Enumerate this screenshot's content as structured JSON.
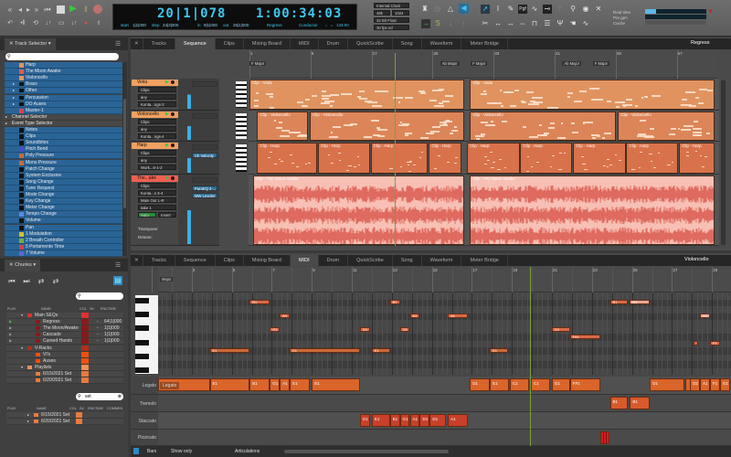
{
  "toolbar": {
    "counter_main": "20|1|078",
    "counter_time": "1:00:34:03",
    "start_label": "start",
    "start": "1|1|000",
    "step_label": "step",
    "step": "24|3|000",
    "in_label": "in",
    "in": "9|1|000",
    "out_label": "out",
    "out": "25|1|000",
    "chunk": "Regress",
    "conductor": "Conductor",
    "tempo": "134.00",
    "clock": "Internal Clock",
    "rate": "48k",
    "buffer": "1024",
    "bit_depth": "32 Bit Float",
    "fps": "30 fps nd",
    "realtime_label": "Real time",
    "pregen_label": "Pre gen",
    "cache_label": "Cache",
    "realtime_level": 0.18,
    "accent": "#3ec7f2"
  },
  "track_selector": {
    "title": "Track Selector",
    "search_placeholder": "",
    "items": [
      {
        "label": "Harp",
        "type": "track",
        "color": "#e8925a"
      },
      {
        "label": "The Moon Awake",
        "type": "track",
        "color": "#e05a4a"
      },
      {
        "label": "Violoncello",
        "type": "track",
        "color": "#e8925a"
      },
      {
        "label": "Brass",
        "type": "folder"
      },
      {
        "label": "Other",
        "type": "folder"
      },
      {
        "label": "Percussion",
        "type": "folder"
      },
      {
        "label": "DO Auxes",
        "type": "folder"
      },
      {
        "label": "Master-1",
        "type": "track",
        "color": "#e0404a"
      },
      {
        "label": "Channel Selector",
        "type": "group"
      },
      {
        "label": "Event Type Selector",
        "type": "group"
      },
      {
        "label": "Notes",
        "type": "event",
        "color": "#111"
      },
      {
        "label": "Clips",
        "type": "event",
        "color": "#111"
      },
      {
        "label": "Soundbites",
        "type": "event",
        "color": "#111"
      },
      {
        "label": "Pitch Bend",
        "type": "event",
        "color": "#4a4ad0"
      },
      {
        "label": "Poly Pressure",
        "type": "event",
        "color": "#c86a3a"
      },
      {
        "label": "Mono Pressure",
        "type": "event",
        "color": "#c86a3a"
      },
      {
        "label": "Patch Change",
        "type": "event",
        "color": "#111"
      },
      {
        "label": "System Exclusive",
        "type": "event",
        "color": "#111"
      },
      {
        "label": "Song Change",
        "type": "event",
        "color": "#111"
      },
      {
        "label": "Tune Request",
        "type": "event",
        "color": "#111"
      },
      {
        "label": "Mode Change",
        "type": "event",
        "color": "#111"
      },
      {
        "label": "Key Change",
        "type": "event",
        "color": "#111"
      },
      {
        "label": "Meter Change",
        "type": "event",
        "color": "#111"
      },
      {
        "label": "Tempo Change",
        "type": "event",
        "color": "#5a8ae0"
      },
      {
        "label": "Volume",
        "type": "event",
        "color": "#111"
      },
      {
        "label": "Pan",
        "type": "event",
        "color": "#111"
      },
      {
        "label": "1     Modulation",
        "type": "event",
        "color": "#d0c030"
      },
      {
        "label": "2     Breath Controller",
        "type": "event",
        "color": "#70b040"
      },
      {
        "label": "5     Portamento Time",
        "type": "event",
        "color": "#d04050"
      },
      {
        "label": "7     Volume",
        "type": "event",
        "color": "#5a6ad0"
      }
    ]
  },
  "chunks": {
    "title": "Chunks",
    "columns": [
      "PLAY",
      "NAME",
      "COL",
      "S#",
      "ENDTIME"
    ],
    "rows": [
      {
        "name": "Main SEQs",
        "level": 0,
        "color": "#e03030",
        "end": ""
      },
      {
        "name": "Regress",
        "level": 1,
        "color": "#8a1a1a",
        "end": "64|1|000",
        "playing": true
      },
      {
        "name": "The Moon/Awake",
        "level": 1,
        "color": "#8a1a1a",
        "end": "1|1|000"
      },
      {
        "name": "Cascade",
        "level": 1,
        "color": "#8a1a1a",
        "end": "1|1|000"
      },
      {
        "name": "Cursed Hands",
        "level": 1,
        "color": "#8a1a1a",
        "end": "1|1|000"
      },
      {
        "name": "V-Racks",
        "level": 0,
        "color": "#b03018",
        "end": ""
      },
      {
        "name": "VI's",
        "level": 1,
        "color": "#f05010",
        "end": ""
      },
      {
        "name": "Auxes",
        "level": 1,
        "color": "#f05010",
        "end": ""
      },
      {
        "name": "Playlists",
        "level": 0,
        "color": "#f0905a",
        "end": ""
      },
      {
        "name": "6/15/2021 Set",
        "level": 1,
        "color": "#e87a40",
        "end": ""
      },
      {
        "name": "6/20/2021 Set",
        "level": 1,
        "color": "#e87a40",
        "end": ""
      }
    ],
    "search2_value": "set",
    "columns2": [
      "PLAY",
      "NAME",
      "COL",
      "S#",
      "ENDTIME",
      "COMMEN"
    ],
    "rows2": [
      {
        "name": "6/15/2021 Set",
        "color": "#e87a40"
      },
      {
        "name": "6/20/2021 Set",
        "color": "#e87a40"
      }
    ]
  },
  "sequence": {
    "tabs": [
      "Tracks",
      "Sequence",
      "Clips",
      "Mixing Board",
      "MIDI",
      "Drum",
      "QuickScribe",
      "Song",
      "Waveform",
      "Meter Bridge"
    ],
    "active_tab": 1,
    "chunk_menu": "Regress",
    "bar_labels": [
      1,
      9,
      17,
      25,
      33,
      41,
      49,
      57
    ],
    "playhead_bar": 20,
    "key_markers": [
      {
        "bar": 1,
        "label": "F Major"
      },
      {
        "bar": 26,
        "label": "Ab Major"
      },
      {
        "bar": 30,
        "label": "F Major"
      },
      {
        "bar": 42,
        "label": "Ab Major"
      },
      {
        "bar": 46,
        "label": "F Major"
      }
    ],
    "tracks": [
      {
        "name": "Viola",
        "color": "#f0a060",
        "clip_color": "#e0935f",
        "fields": [
          "Clips",
          "any",
          "Konta...ngs-3"
        ],
        "slots": [],
        "clips": [
          {
            "label": "Clip - Viola",
            "start": 1,
            "end": 29.1
          },
          {
            "label": "Clip - Viola",
            "start": 29.9,
            "end": 62
          }
        ]
      },
      {
        "name": "Violoncello",
        "color": "#f0a060",
        "clip_color": "#dc8558",
        "fields": [
          "Clips",
          "any",
          "Konta...ngs-4"
        ],
        "slots": [],
        "clips": [
          {
            "label": "Clip - Violoncello",
            "start": 2,
            "end": 8.7
          },
          {
            "label": "Clip - Violoncello",
            "start": 8.9,
            "end": 29.1
          },
          {
            "label": "Clip - Violoncello",
            "start": 29.9,
            "end": 49
          },
          {
            "label": "Clip - Violoncello",
            "start": 49.3,
            "end": 62
          }
        ]
      },
      {
        "name": "Harp",
        "color": "#f0a060",
        "clip_color": "#d8724a",
        "fields": [
          "Clips",
          "any",
          "Work...6-1-2"
        ],
        "slots": [
          "Ch Velocity"
        ],
        "clips": [
          {
            "label": "Clip - Harp",
            "start": 2,
            "end": 9.9
          },
          {
            "label": "Clip - Harp",
            "start": 10,
            "end": 16.8
          },
          {
            "label": "Clip - Harp",
            "start": 16.9,
            "end": 24.4
          },
          {
            "label": "Clip - Harp",
            "start": 24.5,
            "end": 28.8
          },
          {
            "label": "Clip - Harp",
            "start": 29.5,
            "end": 36.4
          },
          {
            "label": "Clip - Harp",
            "start": 36.5,
            "end": 43.3
          },
          {
            "label": "Clip - Harp",
            "start": 43.4,
            "end": 50.3
          },
          {
            "label": "Clip - Harp",
            "start": 50.4,
            "end": 57.2
          },
          {
            "label": "Clip - Harp",
            "start": 57.3,
            "end": 62
          }
        ]
      },
      {
        "name": "The...ake",
        "color": "#f06050",
        "clip_color": "#f8c0b4",
        "fields": [
          "Clips",
          "Konta...s 3-4",
          "Main Out L-R",
          "take 1"
        ],
        "automation": "Auto",
        "insert": "Insert",
        "transpose_label": "Transpose:",
        "detune_label": "Detune:",
        "slots": [
          "ParaEQ 2-...",
          "MW Leveler"
        ],
        "clips": [
          {
            "label": "Clip - The Moon Awake",
            "start": 1.5,
            "end": 29.1
          },
          {
            "label": "Clip - The Moon Awake",
            "start": 29.9,
            "end": 62
          }
        ]
      }
    ]
  },
  "midi_editor": {
    "tabs": [
      "Tracks",
      "Sequence",
      "Clips",
      "Mixing Board",
      "MIDI",
      "Drum",
      "QuickScribe",
      "Song",
      "Waveform",
      "Meter Bridge"
    ],
    "active_tab": 4,
    "track_menu": "Violoncello",
    "bar_labels": [
      3,
      5,
      7,
      9,
      11,
      13,
      15,
      17,
      19,
      21,
      23,
      25,
      27,
      29
    ],
    "key_marker": "Major",
    "playhead_bar": 19.9,
    "notes": [
      {
        "pitch": "B1",
        "start": 5.9,
        "end": 6.9
      },
      {
        "pitch": "B1",
        "start": 12.9,
        "end": 13.4
      },
      {
        "pitch": "B1",
        "start": 23.9,
        "end": 24.8
      },
      {
        "pitch": "B1",
        "start": 24.9,
        "end": 25.9
      },
      {
        "pitch": "A1",
        "start": 7.4,
        "end": 7.9
      },
      {
        "pitch": "A1",
        "start": 13.9,
        "end": 14.4
      },
      {
        "pitch": "A1",
        "start": 15.8,
        "end": 16.8
      },
      {
        "pitch": "A1",
        "start": 28.4,
        "end": 28.9
      },
      {
        "pitch": "G1",
        "start": 6.9,
        "end": 7.4
      },
      {
        "pitch": "G1",
        "start": 11.4,
        "end": 11.9
      },
      {
        "pitch": "G1",
        "start": 13.4,
        "end": 13.9
      },
      {
        "pitch": "D1",
        "start": 21,
        "end": 21.9
      },
      {
        "pitch": "F#1",
        "start": 21.9,
        "end": 23.4
      },
      {
        "pitch": "F1",
        "start": 28.9,
        "end": 29.4
      },
      {
        "pitch": "",
        "start": 28.1,
        "end": 28.3
      },
      {
        "pitch": "E1",
        "start": 3.9,
        "end": 5.9
      },
      {
        "pitch": "E1",
        "start": 7.9,
        "end": 11.4
      },
      {
        "pitch": "E1",
        "start": 12,
        "end": 12.9
      },
      {
        "pitch": "E1",
        "start": 17.9,
        "end": 18.8
      }
    ],
    "lanes": [
      {
        "name": "Legato",
        "color": "#d9652a",
        "blocks": [
          {
            "l": "",
            "s": 1.3,
            "e": 3.9
          },
          {
            "l": "E1",
            "s": 3.9,
            "e": 5.9
          },
          {
            "l": "B1",
            "s": 5.9,
            "e": 6.9
          },
          {
            "l": "G1",
            "s": 6.9,
            "e": 7.4
          },
          {
            "l": "A1",
            "s": 7.4,
            "e": 7.9
          },
          {
            "l": "E1",
            "s": 7.9,
            "e": 8.9
          },
          {
            "l": "E1",
            "s": 9,
            "e": 11.4
          },
          {
            "l": "D1",
            "s": 16.9,
            "e": 17.9
          },
          {
            "l": "E1",
            "s": 17.9,
            "e": 18.85
          },
          {
            "l": "C1",
            "s": 18.9,
            "e": 19.85
          },
          {
            "l": "C1",
            "s": 19.95,
            "e": 20.9
          },
          {
            "l": "G1",
            "s": 21,
            "e": 21.9
          },
          {
            "l": "F#1",
            "s": 21.9,
            "e": 23.4
          },
          {
            "l": "D1",
            "s": 25.9,
            "e": 27.6
          },
          {
            "l": "",
            "s": 27.65,
            "e": 27.85
          },
          {
            "l": "D2",
            "s": 27.9,
            "e": 28.4
          },
          {
            "l": "A1",
            "s": 28.4,
            "e": 28.9
          },
          {
            "l": "F1",
            "s": 28.9,
            "e": 29.4
          },
          {
            "l": "G1",
            "s": 29.4,
            "e": 29.9
          }
        ]
      },
      {
        "name": "Tremolo",
        "color": "#d85a2a",
        "blocks": [
          {
            "l": "B1",
            "s": 23.9,
            "e": 24.8
          },
          {
            "l": "B1",
            "s": 24.9,
            "e": 25.9
          }
        ]
      },
      {
        "name": "Staccato",
        "color": "#c8402a",
        "blocks": [
          {
            "l": "G1",
            "s": 11.4,
            "e": 11.9
          },
          {
            "l": "E1",
            "s": 12,
            "e": 12.9
          },
          {
            "l": "B1",
            "s": 12.9,
            "e": 13.4
          },
          {
            "l": "G1",
            "s": 13.4,
            "e": 13.9
          },
          {
            "l": "A1",
            "s": 13.9,
            "e": 14.4
          },
          {
            "l": "D1",
            "s": 14.4,
            "e": 14.9
          },
          {
            "l": "D1",
            "s": 14.9,
            "e": 15.7
          },
          {
            "l": "A1",
            "s": 15.8,
            "e": 16.8
          }
        ]
      },
      {
        "name": "Pizzicato",
        "color": "#d02020",
        "blocks": [
          {
            "l": "",
            "s": 23.4,
            "e": 23.9
          }
        ]
      }
    ],
    "legato_chip": "Legato",
    "footer": {
      "grid": "Bars",
      "show_only": "Show only",
      "lane_menu": "Articulations"
    }
  }
}
